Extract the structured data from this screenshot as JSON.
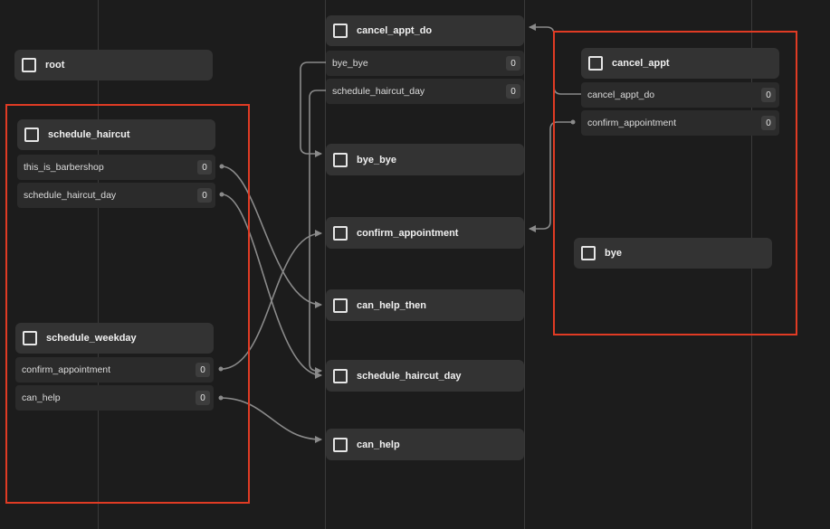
{
  "nodes": {
    "root": "root",
    "schedule_haircut": {
      "title": "schedule_haircut",
      "rows": [
        {
          "label": "this_is_barbershop",
          "count": "0"
        },
        {
          "label": "schedule_haircut_day",
          "count": "0"
        }
      ]
    },
    "schedule_weekday": {
      "title": "schedule_weekday",
      "rows": [
        {
          "label": "confirm_appointment",
          "count": "0"
        },
        {
          "label": "can_help",
          "count": "0"
        }
      ]
    },
    "cancel_appt_do": {
      "title": "cancel_appt_do",
      "rows": [
        {
          "label": "bye_bye",
          "count": "0"
        },
        {
          "label": "schedule_haircut_day",
          "count": "0"
        }
      ]
    },
    "bye_bye": "bye_bye",
    "confirm_appointment": "confirm_appointment",
    "can_help_then": "can_help_then",
    "schedule_haircut_day": "schedule_haircut_day",
    "can_help": "can_help",
    "cancel_appt": {
      "title": "cancel_appt",
      "rows": [
        {
          "label": "cancel_appt_do",
          "count": "0"
        },
        {
          "label": "confirm_appointment",
          "count": "0"
        }
      ]
    },
    "bye": "bye"
  },
  "colors": {
    "background": "#1c1c1c",
    "node": "#333333",
    "row": "#2b2b2b",
    "connector": "#8a8a8a",
    "highlight_box": "#e03b24"
  }
}
